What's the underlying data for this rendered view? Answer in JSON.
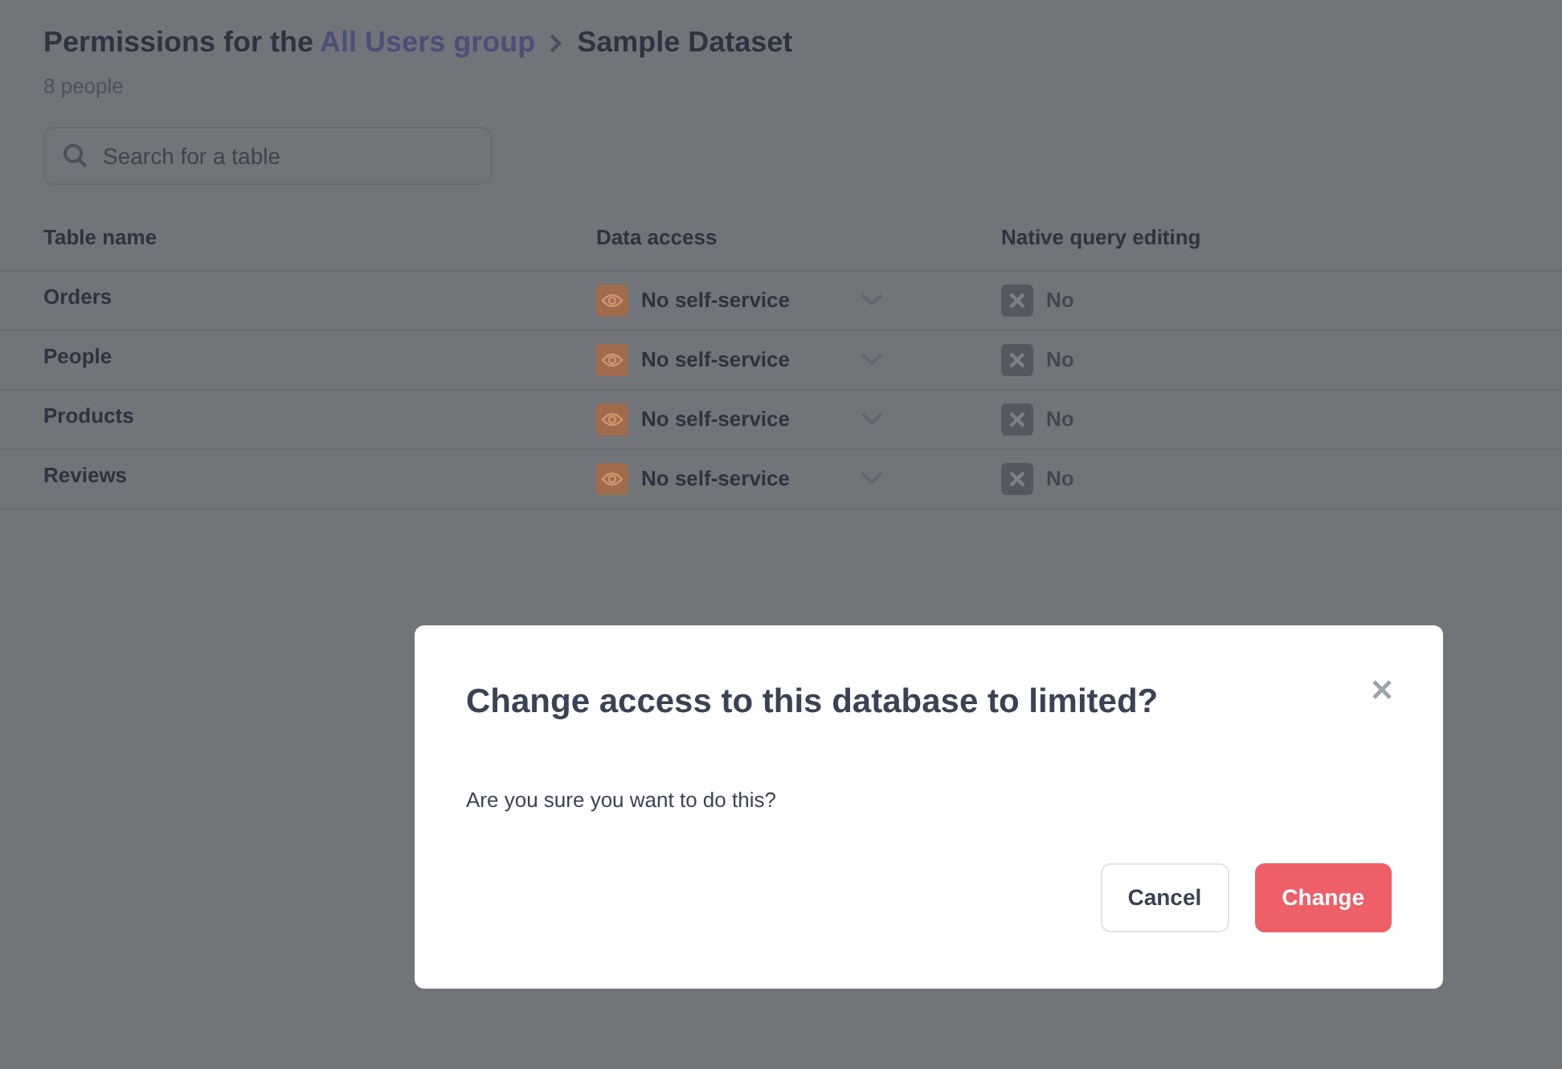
{
  "header": {
    "title_prefix": "Permissions for the",
    "group_link": "All Users group",
    "breadcrumb": "Sample Dataset",
    "subtitle": "8 people"
  },
  "search": {
    "placeholder": "Search for a table"
  },
  "table": {
    "columns": [
      "Table name",
      "Data access",
      "Native query editing"
    ],
    "rows": [
      {
        "name": "Orders",
        "data_access": "No self-service",
        "native_query": "No"
      },
      {
        "name": "People",
        "data_access": "No self-service",
        "native_query": "No"
      },
      {
        "name": "Products",
        "data_access": "No self-service",
        "native_query": "No"
      },
      {
        "name": "Reviews",
        "data_access": "No self-service",
        "native_query": "No"
      }
    ]
  },
  "dialog": {
    "title": "Change access to this database to limited?",
    "message": "Are you sure you want to do this?",
    "buttons": [
      {
        "label": "Cancel",
        "kind": "secondary"
      },
      {
        "label": "Change",
        "kind": "danger"
      }
    ]
  }
}
